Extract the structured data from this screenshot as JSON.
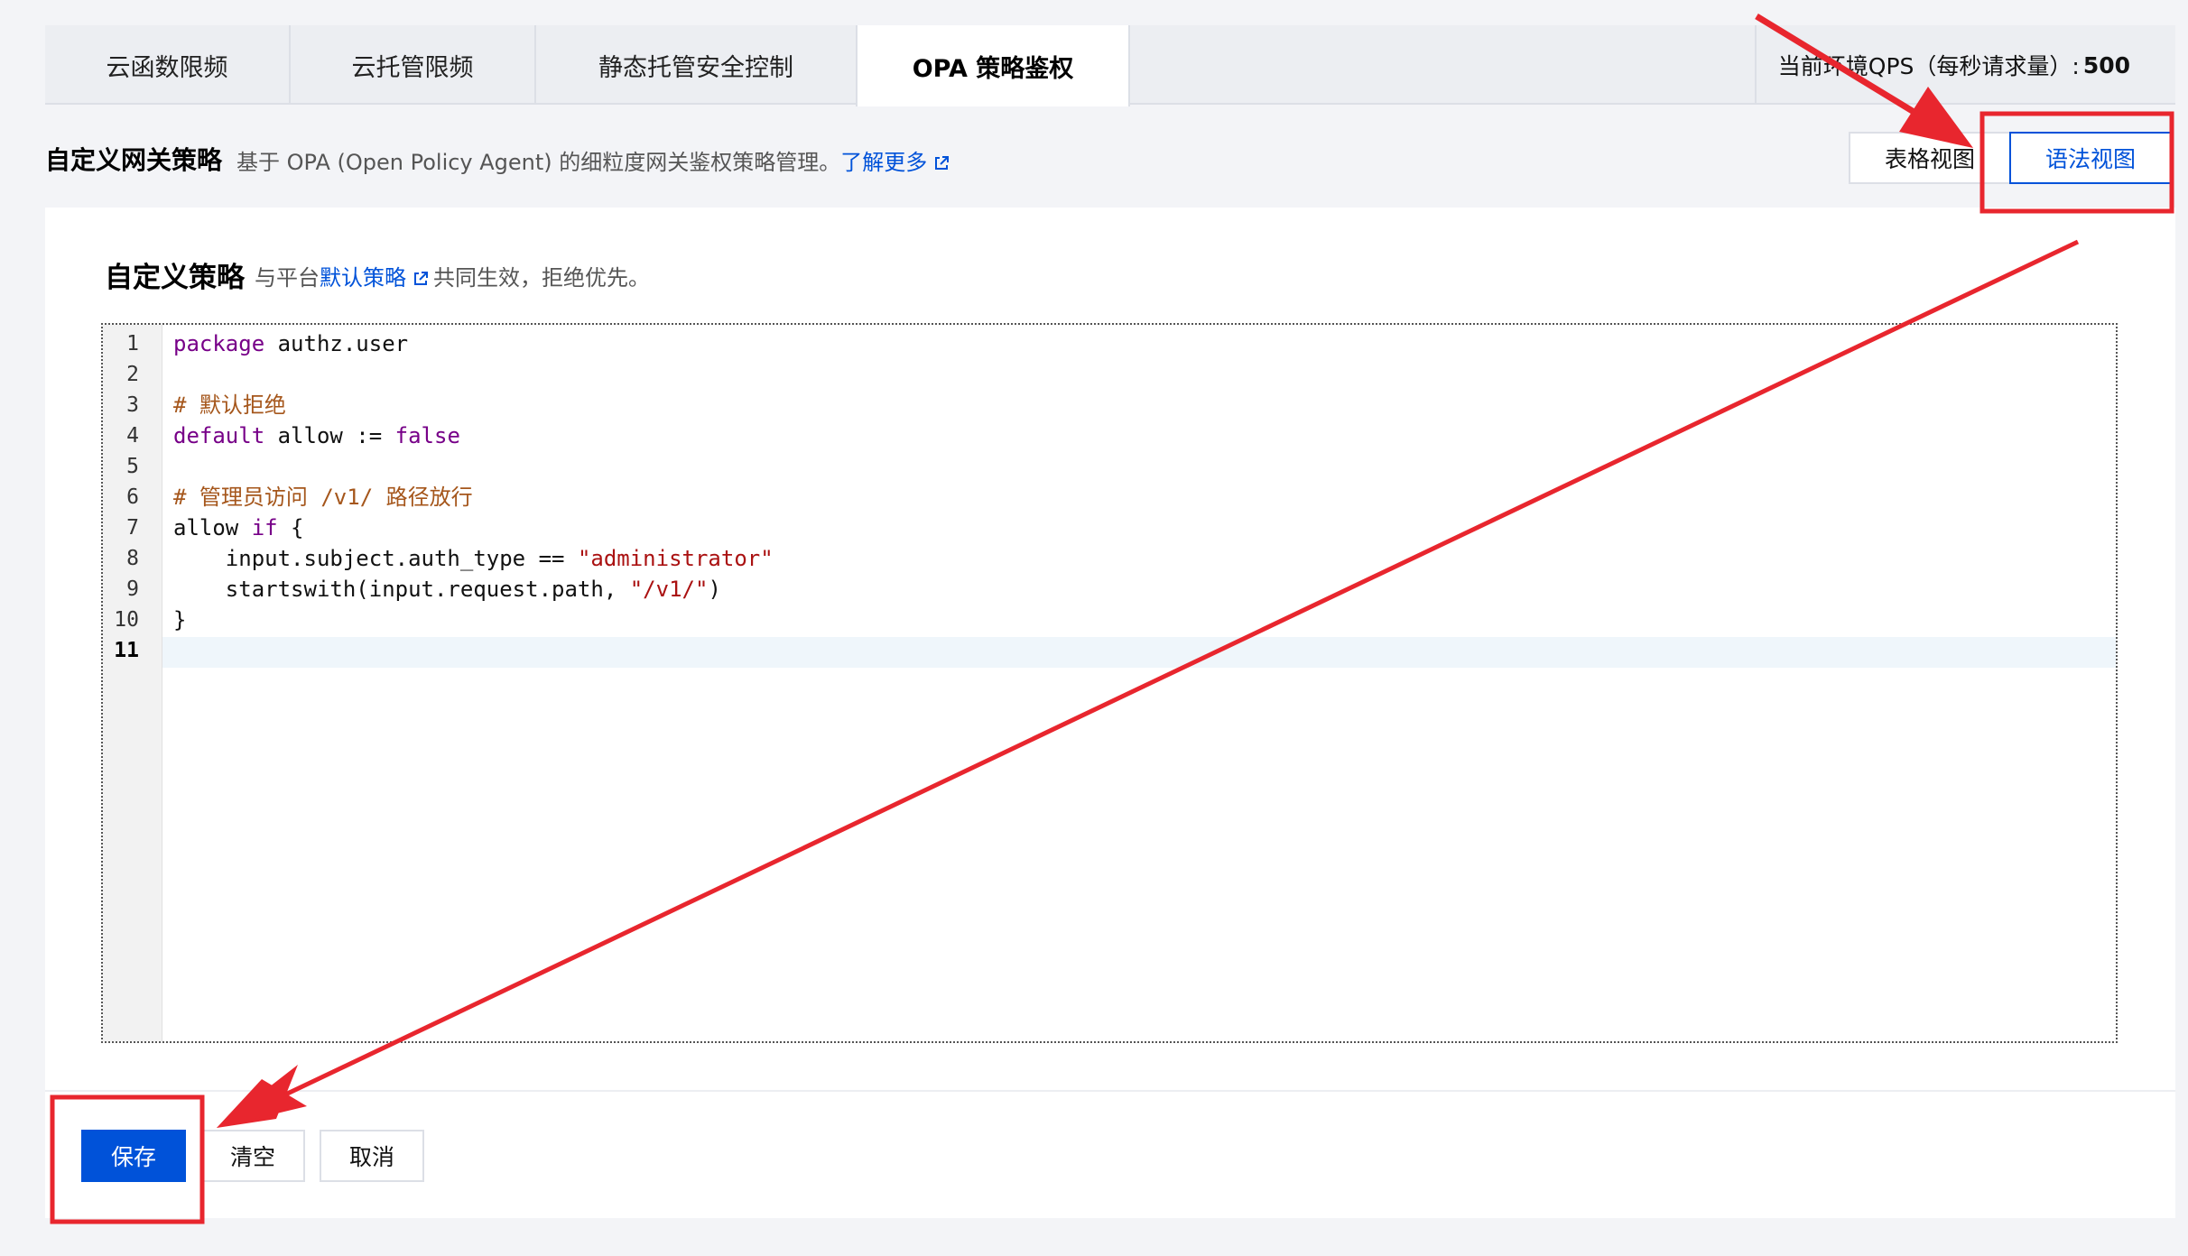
{
  "tabs": [
    {
      "label": "云函数限频"
    },
    {
      "label": "云托管限频"
    },
    {
      "label": "静态托管安全控制"
    },
    {
      "label": "OPA 策略鉴权"
    }
  ],
  "qps": {
    "label": "当前环境QPS（每秒请求量）:",
    "value": "500"
  },
  "header": {
    "title": "自定义网关策略",
    "description": "基于 OPA (Open Policy Agent) 的细粒度网关鉴权策略管理。",
    "learn_more": "了解更多"
  },
  "views": {
    "table": "表格视图",
    "syntax": "语法视图"
  },
  "card": {
    "title": "自定义策略",
    "desc_prefix": "与平台",
    "desc_link": "默认策略",
    "desc_suffix": "共同生效，拒绝优先。"
  },
  "editor": {
    "lines": [
      "package authz.user",
      "",
      "# 默认拒绝",
      "default allow := false",
      "",
      "# 管理员访问 /v1/ 路径放行",
      "allow if {",
      "    input.subject.auth_type == \"administrator\"",
      "    startswith(input.request.path, \"/v1/\")",
      "}",
      ""
    ],
    "line_numbers": [
      "1",
      "2",
      "3",
      "4",
      "5",
      "6",
      "7",
      "8",
      "9",
      "10",
      "11"
    ]
  },
  "footer": {
    "save": "保存",
    "clear": "清空",
    "cancel": "取消"
  },
  "colors": {
    "primary": "#0052d9",
    "annotation": "#e8262e",
    "keyword": "#770088",
    "comment": "#a5561b",
    "string": "#aa1111"
  }
}
